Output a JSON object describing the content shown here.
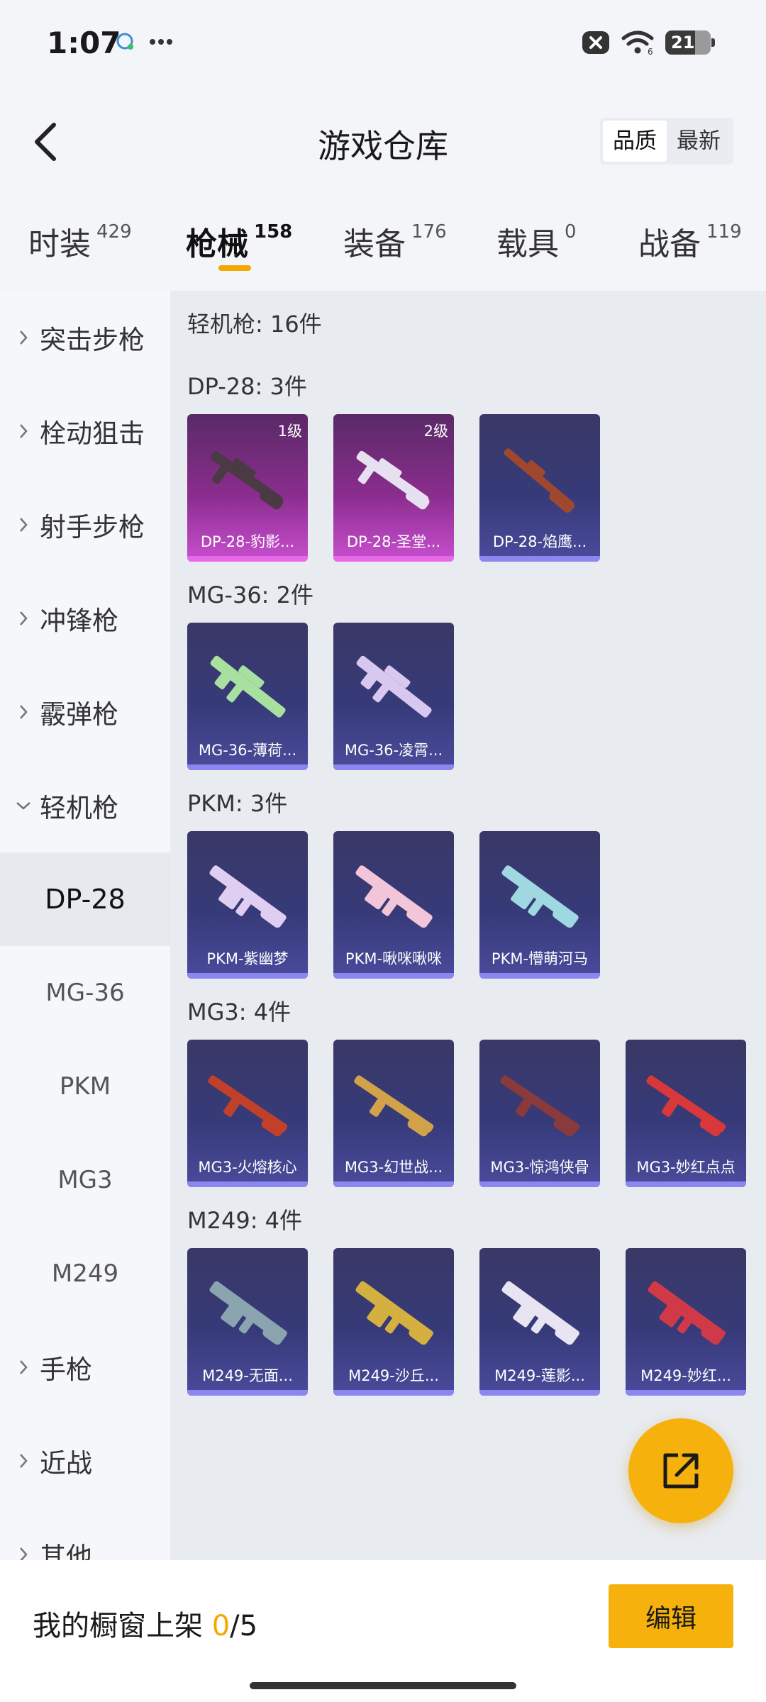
{
  "status_bar": {
    "time": "1:07",
    "left_icons": [
      "chat-bubble-icon",
      "more-dots-icon"
    ],
    "right_icons": [
      "close-box-icon",
      "wifi-icon"
    ],
    "battery_level": "21"
  },
  "header": {
    "title": "游戏仓库",
    "sort_options": [
      {
        "label": "品质",
        "active": true
      },
      {
        "label": "最新",
        "active": false
      }
    ]
  },
  "category_tabs": [
    {
      "label": "时装",
      "count": "429",
      "active": false
    },
    {
      "label": "枪械",
      "count": "158",
      "active": true
    },
    {
      "label": "装备",
      "count": "176",
      "active": false
    },
    {
      "label": "载具",
      "count": "0",
      "active": false
    },
    {
      "label": "战备",
      "count": "119",
      "active": false
    }
  ],
  "side_nav": {
    "items": [
      {
        "label": "突击步枪",
        "expanded": false
      },
      {
        "label": "栓动狙击",
        "expanded": false
      },
      {
        "label": "射手步枪",
        "expanded": false
      },
      {
        "label": "冲锋枪",
        "expanded": false
      },
      {
        "label": "霰弹枪",
        "expanded": false
      },
      {
        "label": "轻机枪",
        "expanded": true
      },
      {
        "label": "手枪",
        "expanded": false
      },
      {
        "label": "近战",
        "expanded": false
      },
      {
        "label": "其他",
        "expanded": false
      }
    ],
    "sub_items": [
      {
        "label": "DP-28",
        "active": true
      },
      {
        "label": "MG-36",
        "active": false
      },
      {
        "label": "PKM",
        "active": false
      },
      {
        "label": "MG3",
        "active": false
      },
      {
        "label": "M249",
        "active": false
      }
    ]
  },
  "content": {
    "section_title": "轻机枪: 16件",
    "groups": [
      {
        "title": "DP-28: 3件",
        "items": [
          {
            "name": "DP-28-豹影...",
            "badge": "1级",
            "rarity": "epic",
            "gun_color": "#4a3a44"
          },
          {
            "name": "DP-28-圣堂...",
            "badge": "2级",
            "rarity": "epic",
            "gun_color": "#e7e0f0"
          },
          {
            "name": "DP-28-焰鹰...",
            "badge": "",
            "rarity": "rare",
            "gun_color": "#a0482e"
          }
        ]
      },
      {
        "title": "MG-36: 2件",
        "items": [
          {
            "name": "MG-36-薄荷...",
            "badge": "",
            "rarity": "rare",
            "gun_color": "#a8e0a0"
          },
          {
            "name": "MG-36-凌霄...",
            "badge": "",
            "rarity": "rare",
            "gun_color": "#d8c8f0"
          }
        ]
      },
      {
        "title": "PKM: 3件",
        "items": [
          {
            "name": "PKM-紫幽梦",
            "badge": "",
            "rarity": "rare",
            "gun_color": "#e0cdf2"
          },
          {
            "name": "PKM-啾咪啾咪",
            "badge": "",
            "rarity": "rare",
            "gun_color": "#f2c6d8"
          },
          {
            "name": "PKM-懵萌河马",
            "badge": "",
            "rarity": "rare",
            "gun_color": "#9fd8e0"
          }
        ]
      },
      {
        "title": "MG3: 4件",
        "items": [
          {
            "name": "MG3-火熔核心",
            "badge": "",
            "rarity": "rare",
            "gun_color": "#c0402a"
          },
          {
            "name": "MG3-幻世战...",
            "badge": "",
            "rarity": "rare",
            "gun_color": "#d2a24a"
          },
          {
            "name": "MG3-惊鸿侠骨",
            "badge": "",
            "rarity": "rare",
            "gun_color": "#8a3a3a"
          },
          {
            "name": "MG3-妙红点点",
            "badge": "",
            "rarity": "rare",
            "gun_color": "#d8383a"
          }
        ]
      },
      {
        "title": "M249: 4件",
        "items": [
          {
            "name": "M249-无面...",
            "badge": "",
            "rarity": "rare",
            "gun_color": "#8aa4b0"
          },
          {
            "name": "M249-沙丘...",
            "badge": "",
            "rarity": "rare",
            "gun_color": "#d4b040"
          },
          {
            "name": "M249-莲影...",
            "badge": "",
            "rarity": "rare",
            "gun_color": "#e8e4f2"
          },
          {
            "name": "M249-妙红...",
            "badge": "",
            "rarity": "rare",
            "gun_color": "#d03a48"
          }
        ]
      }
    ]
  },
  "fab": {
    "icon": "share-external-icon"
  },
  "bottom_panel": {
    "showcase_label": "我的橱窗上架",
    "showcase_count": "0",
    "showcase_total": "/5",
    "edit_label": "编辑"
  },
  "colors": {
    "accent": "#f6b10c",
    "epic_card": "#c94fcf",
    "rare_card": "#4a4b9c"
  }
}
